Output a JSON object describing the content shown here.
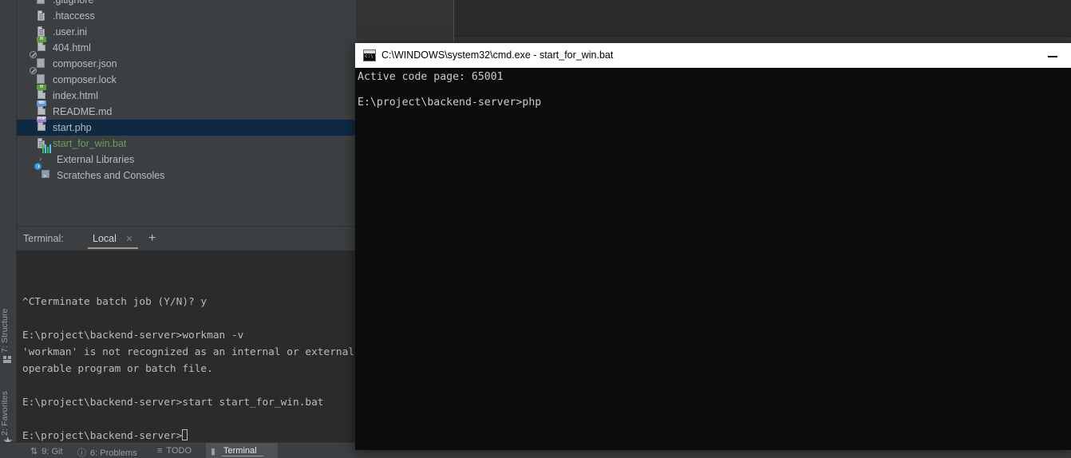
{
  "ide": {
    "tool_strip": {
      "structure_label": "7: Structure",
      "favorites_label": "2: Favorites",
      "star_icon": "star-icon"
    },
    "project_tree": [
      {
        "name": ".gitignore",
        "icon": "gitignore-file-icon",
        "depth": 1,
        "selected": false,
        "color": "#bbbbbb"
      },
      {
        "name": ".htaccess",
        "icon": "text-file-icon",
        "depth": 1,
        "selected": false,
        "color": "#bbbbbb"
      },
      {
        "name": ".user.ini",
        "icon": "text-file-icon",
        "depth": 1,
        "selected": false,
        "color": "#bbbbbb"
      },
      {
        "name": "404.html",
        "icon": "html-file-icon",
        "depth": 1,
        "selected": false,
        "color": "#bbbbbb"
      },
      {
        "name": "composer.json",
        "icon": "composer-file-icon",
        "depth": 1,
        "selected": false,
        "color": "#bbbbbb"
      },
      {
        "name": "composer.lock",
        "icon": "composer-file-icon",
        "depth": 1,
        "selected": false,
        "color": "#bbbbbb"
      },
      {
        "name": "index.html",
        "icon": "html-file-icon",
        "depth": 1,
        "selected": false,
        "color": "#bbbbbb"
      },
      {
        "name": "README.md",
        "icon": "markdown-file-icon",
        "depth": 1,
        "selected": false,
        "color": "#bbbbbb"
      },
      {
        "name": "start.php",
        "icon": "php-file-icon",
        "depth": 1,
        "selected": true,
        "color": "#bbbbbb"
      },
      {
        "name": "start_for_win.bat",
        "icon": "text-file-icon",
        "depth": 1,
        "selected": false,
        "color": "#6a9e5e"
      },
      {
        "name": "External Libraries",
        "icon": "libraries-icon",
        "depth": 0,
        "selected": false,
        "color": "#bbbbbb",
        "expander": "›"
      },
      {
        "name": "Scratches and Consoles",
        "icon": "scratches-icon",
        "depth": 0,
        "selected": false,
        "color": "#bbbbbb"
      }
    ],
    "terminal": {
      "title": "Terminal:",
      "tab_label": "Local",
      "tab_close_icon": "close-icon",
      "add_tab_icon": "plus-icon",
      "lines": [
        "",
        "",
        "^CTerminate batch job (Y/N)? y",
        "",
        "E:\\project\\backend-server>workman -v",
        "'workman' is not recognized as an internal or external",
        "operable program or batch file.",
        "",
        "E:\\project\\backend-server>start start_for_win.bat",
        "",
        "E:\\project\\backend-server>"
      ]
    },
    "statusbar": {
      "items": [
        {
          "label": "9: Git",
          "icon": "git-icon"
        },
        {
          "label": "6: Problems",
          "icon": "warning-icon"
        },
        {
          "label": "TODO",
          "icon": "todo-icon"
        }
      ],
      "active": {
        "label": "Terminal",
        "icon": "terminal-icon"
      }
    }
  },
  "cmd_window": {
    "title": "C:\\WINDOWS\\system32\\cmd.exe - start_for_win.bat",
    "title_icon": "cmd-console-icon",
    "minimize_icon": "minimize-icon",
    "lines": [
      "Active code page: 65001",
      "",
      "E:\\project\\backend-server>php"
    ]
  }
}
